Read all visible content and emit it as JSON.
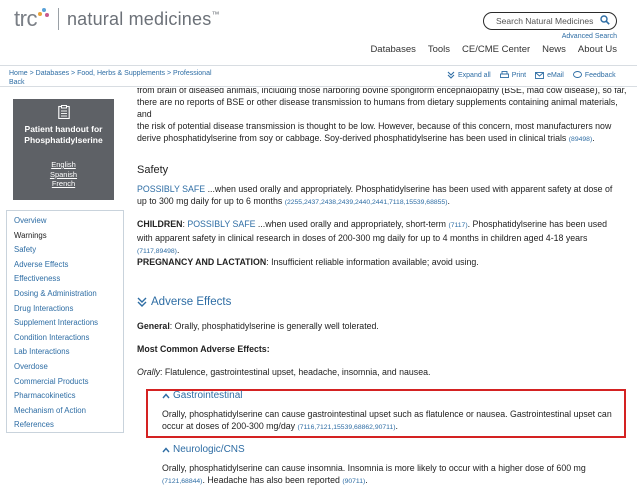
{
  "header": {
    "logo_trc": "trc",
    "logo_name": "natural medicines",
    "logo_tm": "™",
    "search_placeholder": "Search Natural Medicines",
    "advanced_search": "Advanced Search",
    "nav": [
      "Databases",
      "Tools",
      "CE/CME Center",
      "News",
      "About Us"
    ]
  },
  "breadcrumb": {
    "text": "Home > Databases > Food, Herbs & Supplements > Professional Back"
  },
  "tools": {
    "expand_all": "Expand all",
    "print": "Print",
    "email": "eMail",
    "feedback": "Feedback"
  },
  "handout": {
    "title": "Patient handout for Phosphatidylserine",
    "languages": [
      "English",
      "Spanish",
      "French"
    ]
  },
  "sidenav": {
    "items": [
      "Overview",
      "Warnings",
      "Safety",
      "Adverse Effects",
      "Effectiveness",
      "Dosing & Administration",
      "Drug Interactions",
      "Supplement Interactions",
      "Condition Interactions",
      "Lab Interactions",
      "Overdose",
      "Commercial Products",
      "Pharmacokinetics",
      "Mechanism of Action",
      "References"
    ],
    "active_index": 1
  },
  "intro": {
    "cut_line": "from brain of diseased animals, including those harboring bovine spongiform encephalopathy (BSE, mad cow disease), so far,",
    "line2": "there are no reports of BSE or other disease transmission to humans from dietary supplements containing animal materials, and",
    "line3": "the risk of potential disease transmission is thought to be low. However, because of this concern, most manufacturers now",
    "line4": "derive phosphatidylserine from soy or cabbage. Soy-derived phosphatidylserine has been used in clinical trials",
    "line4_ref": "(89498)",
    "line4_end": "."
  },
  "safety": {
    "title": "Safety",
    "possibly_label": "POSSIBLY SAFE",
    "possibly_text": " ...when used orally and appropriately. Phosphatidylserine has been used with apparent safety at dose of up to 300 mg daily for up to 6 months ",
    "possibly_refs": "(2255,2437,2438,2439,2440,2441,7118,15539,68855)",
    "possibly_end": ".",
    "children_label": "CHILDREN",
    "children_colon": ": ",
    "children_possibly": "POSSIBLY SAFE",
    "children_text": " ...when used orally and appropriately, short-term ",
    "children_ref1": "(7117)",
    "children_text2": ". Phosphatidylserine has been used with apparent safety in clinical research in doses of 200-300 mg daily for up to 4 months in children aged 4-18 years ",
    "children_ref2": "(7117,89498)",
    "children_end": ".",
    "preg_label": "PREGNANCY AND LACTATION",
    "preg_text": ": Insufficient reliable information available; avoid using."
  },
  "adverse": {
    "title": "Adverse Effects",
    "general_label": "General",
    "general_text": ": Orally, phosphatidylserine is generally well tolerated.",
    "most_common": "Most Common Adverse Effects:",
    "orally_label": "Orally",
    "orally_text": ": Flatulence, gastrointestinal upset, headache, insomnia, and nausea.",
    "gi_title": "Gastrointestinal",
    "gi_text": "Orally, phosphatidylserine can cause gastrointestinal upset such as flatulence or nausea. Gastrointestinal upset can occur at doses of 200-300 mg/day ",
    "gi_refs": "(7116,7121,15539,68862,90711)",
    "gi_end": ".",
    "neuro_title": "Neurologic/CNS",
    "neuro_text": "Orally, phosphatidylserine can cause insomnia. Insomnia is more likely to occur with a higher dose of 600 mg ",
    "neuro_refs1": "(7121,68844)",
    "neuro_text2": ". Headache has also been reported ",
    "neuro_refs2": "(90711)",
    "neuro_end": "."
  },
  "colors": {
    "link": "#2e6da4",
    "highlight_border": "#d42222",
    "handout_bg": "#5e6166"
  }
}
